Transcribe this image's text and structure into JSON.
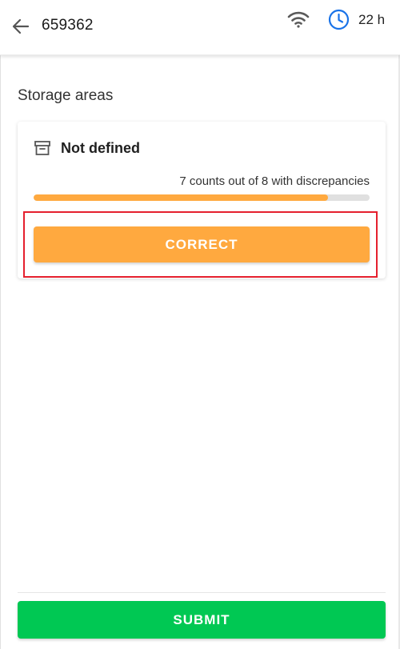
{
  "header": {
    "title": "659362",
    "back_icon": "arrow-left-icon",
    "wifi_icon": "wifi-icon",
    "clock_icon": "clock-icon",
    "clock_label": "22 h"
  },
  "section": {
    "title": "Storage areas"
  },
  "card": {
    "icon": "archive-icon",
    "title": "Not defined",
    "progress_text": "7 counts out of 8 with discrepancies",
    "progress_fraction": 0.875,
    "correct_label": "CORRECT"
  },
  "footer": {
    "submit_label": "SUBMIT"
  },
  "colors": {
    "accent_orange": "#ffa93f",
    "submit_green": "#00c853",
    "clock_blue": "#1a73e8",
    "highlight_red": "#e5202e",
    "track_gray": "#e0e0e0"
  }
}
